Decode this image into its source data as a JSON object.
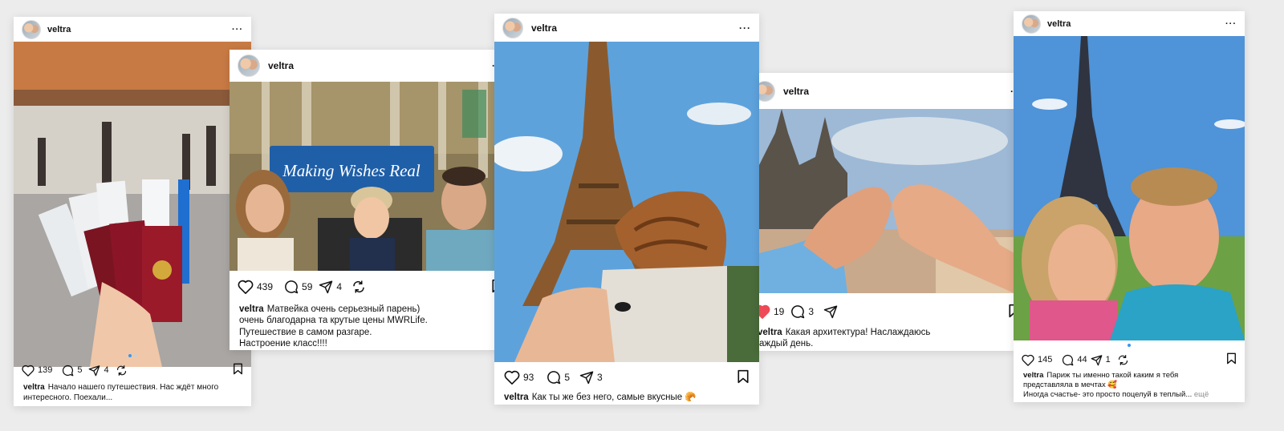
{
  "username": "veltra",
  "more_glyph": "···",
  "colors": {
    "like_red": "#ed4956",
    "carousel_active": "#3897f0",
    "background": "#ececec"
  },
  "icons": [
    "heart-icon",
    "comment-icon",
    "share-icon",
    "repost-icon",
    "bookmark-icon",
    "more-icon"
  ],
  "posts": [
    {
      "username": "veltra",
      "photo": "airport-passports",
      "likes": "139",
      "comments": "5",
      "shares": "4",
      "caption": "Начало нашего путешествия. Нас ждёт много интересного. Поехали..."
    },
    {
      "username": "veltra",
      "photo": "family-sagrada",
      "banner_text": "Making Wishes Real",
      "likes": "439",
      "comments": "59",
      "shares": "4",
      "caption_lines": [
        "Матвейка очень серьезный парень)",
        "очень благодарна та крутые цены MWRLife.",
        "Путешествие в самом разгаре.",
        "Настроение класс!!!!"
      ]
    },
    {
      "username": "veltra",
      "photo": "eiffel-croissant",
      "likes": "93",
      "comments": "5",
      "shares": "3",
      "caption": "Как ты же без него, самые вкусные 🥐"
    },
    {
      "username": "veltra",
      "photo": "prague-heart",
      "likes": "19",
      "comments": "3",
      "liked": true,
      "caption_lines": [
        "Какая архитектура! Наслаждаюсь",
        "аждый день."
      ]
    },
    {
      "username": "veltra",
      "photo": "eiffel-kiss",
      "likes": "145",
      "comments": "44",
      "shares": "1",
      "caption_lines": [
        "Париж ты именно такой каким я тебя",
        "представляла в мечтах 🥰",
        "Иногда счастье- это просто поцелуй в теплый..."
      ],
      "more_label": "ещё"
    }
  ]
}
